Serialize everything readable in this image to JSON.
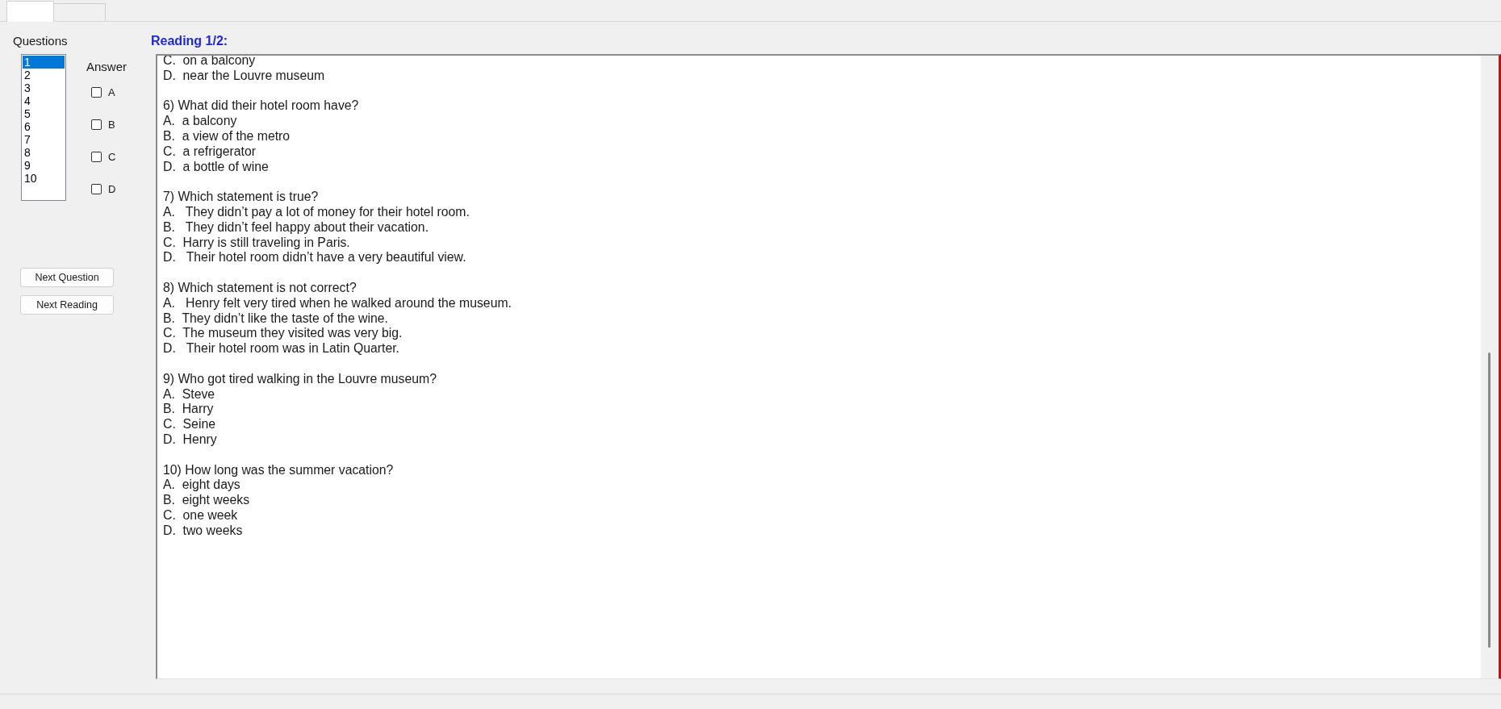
{
  "tabs": [
    {
      "selected": true
    },
    {
      "selected": false
    }
  ],
  "questions": {
    "label": "Questions",
    "items": [
      {
        "label": "1",
        "selected": true
      },
      {
        "label": "2",
        "selected": false
      },
      {
        "label": "3",
        "selected": false
      },
      {
        "label": "4",
        "selected": false
      },
      {
        "label": "5",
        "selected": false
      },
      {
        "label": "6",
        "selected": false
      },
      {
        "label": "7",
        "selected": false
      },
      {
        "label": "8",
        "selected": false
      },
      {
        "label": "9",
        "selected": false
      },
      {
        "label": "10",
        "selected": false
      }
    ]
  },
  "answer": {
    "label": "Answer",
    "options": [
      {
        "label": "A",
        "checked": false
      },
      {
        "label": "B",
        "checked": false
      },
      {
        "label": "C",
        "checked": false
      },
      {
        "label": "D",
        "checked": false
      }
    ]
  },
  "buttons": [
    {
      "label": "Next Question"
    },
    {
      "label": "Next Reading"
    }
  ],
  "reading": {
    "title": "Reading 1/2:",
    "continued_options": [
      "C.  on a balcony",
      "D.  near the Louvre museum"
    ],
    "questions": [
      {
        "text": "6) What did their hotel room have?",
        "options": [
          "A.  a balcony",
          "B.  a view of the metro",
          "C.  a refrigerator",
          "D.  a bottle of wine"
        ]
      },
      {
        "text": "7) Which statement is true?",
        "options": [
          "A.   They didn’t pay a lot of money for their hotel room.",
          "B.   They didn’t feel happy about their vacation.",
          "C.  Harry is still traveling in Paris.",
          "D.   Their hotel room didn’t have a very beautiful view."
        ]
      },
      {
        "text": "8) Which statement is not correct?",
        "options": [
          "A.   Henry felt very tired when he walked around the museum.",
          "B.  They didn’t like the taste of the wine.",
          "C.  The museum they visited was very big.",
          "D.   Their hotel room was in Latin Quarter."
        ]
      },
      {
        "text": "9) Who got tired walking in the Louvre museum?",
        "options": [
          "A.  Steve",
          "B.  Harry",
          "C.  Seine",
          "D.  Henry"
        ]
      },
      {
        "text": "10) How long was the summer vacation?",
        "options": [
          "A.  eight days",
          "B.  eight weeks",
          "C.  one week",
          "D.  two weeks"
        ]
      }
    ]
  }
}
